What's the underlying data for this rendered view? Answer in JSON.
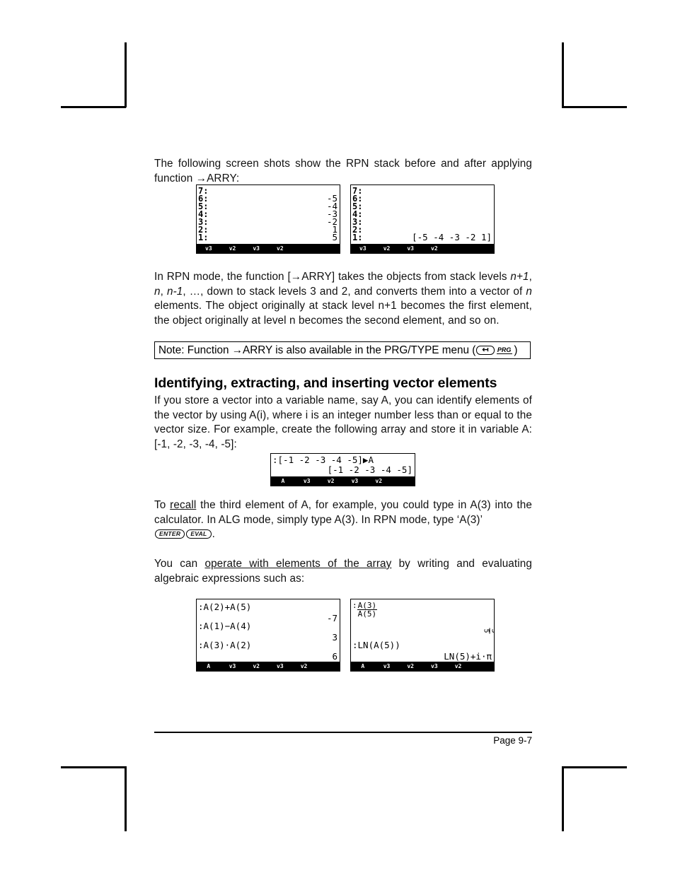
{
  "document": {
    "page_number": "Page 9-7"
  },
  "paragraphs": {
    "intro_1": "The following screen shots show the RPN stack before and after applying function ",
    "intro_1_fn": "→ARRY:",
    "rpn_desc_a": "In RPN mode, the function [",
    "rpn_desc_b": "→ARRY]  takes the objects from stack levels ",
    "rpn_n1": "n+1",
    "rpn_comma": ", ",
    "rpn_n": "n",
    "rpn_c2": ", ",
    "rpn_nm1": "n-1",
    "rpn_desc_c": ", …, down to stack levels 3 and 2, and converts them into a vector of ",
    "rpn_n2": "n",
    "rpn_desc_d": " elements.   The object originally at stack level n+1 becomes the first element, the object originally at level n becomes the second element, and so on.",
    "identify_1": "If you store a vector into a variable name, say A, you can identify elements of the vector by using A(i), where i is an integer number less than or equal to the vector size.   For example, create the following array and store it in variable A: [-1, -2, -3, -4, -5]:",
    "recall_a": "To ",
    "recall_link": "recall",
    "recall_b": " the third element of A, for example, you could type in A(3) into the calculator.   In ALG mode, simply type A(3).   In RPN mode, type ‘A(3)’",
    "recall_c": ".",
    "operate_a": "You can ",
    "operate_link": "operate with elements of the array",
    "operate_b": " by writing and evaluating algebraic expressions such as:"
  },
  "heading": {
    "text": "Identifying, extracting, and inserting vector elements"
  },
  "note": {
    "prefix": "Note: Function →ARRY is also available in the PRG/TYPE menu (",
    "shift_key": "↤",
    "prg_label": "PRG",
    "suffix": ")"
  },
  "keys": {
    "enter": "ENTER",
    "eval": "EVAL"
  },
  "calculators": {
    "stack_before": {
      "levels": [
        "7:",
        "6:",
        "5:",
        "4:",
        "3:",
        "2:",
        "1:"
      ],
      "values": [
        "",
        "-5",
        "-4",
        "-3",
        "-2",
        "1",
        "5"
      ],
      "softkeys": [
        "v3",
        "v2",
        "v3",
        "v2",
        "",
        ""
      ]
    },
    "stack_after": {
      "levels": [
        "7:",
        "6:",
        "5:",
        "4:",
        "3:",
        "2:",
        "1:"
      ],
      "values": [
        "",
        "",
        "",
        "",
        "",
        "",
        "[-5 -4 -3 -2 1]"
      ],
      "softkeys": [
        "v3",
        "v2",
        "v3",
        "v2",
        "",
        ""
      ]
    },
    "store_array": {
      "input": ":[-1 -2 -3 -4 -5]▶A",
      "result": "[-1 -2 -3 -4 -5]",
      "softkeys": [
        "A",
        "v3",
        "v2",
        "v3",
        "v2",
        ""
      ]
    },
    "expressions_1": {
      "rows": [
        {
          "expr": ":A(2)+A(5)",
          "value": "-7"
        },
        {
          "expr": ":A(1)−A(4)",
          "value": "3"
        },
        {
          "expr": ":A(3)·A(2)",
          "value": "6"
        }
      ],
      "softkeys": [
        "A",
        "v3",
        "v2",
        "v3",
        "v2",
        ""
      ]
    },
    "expressions_2": {
      "fraction_numerator": "A(3)",
      "fraction_denominator": "A(5)",
      "fraction_value_num": "3",
      "fraction_value_den": "5",
      "ln_expr": ":LN(A(5))",
      "ln_value": "LN(5)+i·π",
      "softkeys": [
        "A",
        "v3",
        "v2",
        "v3",
        "v2",
        ""
      ]
    }
  }
}
